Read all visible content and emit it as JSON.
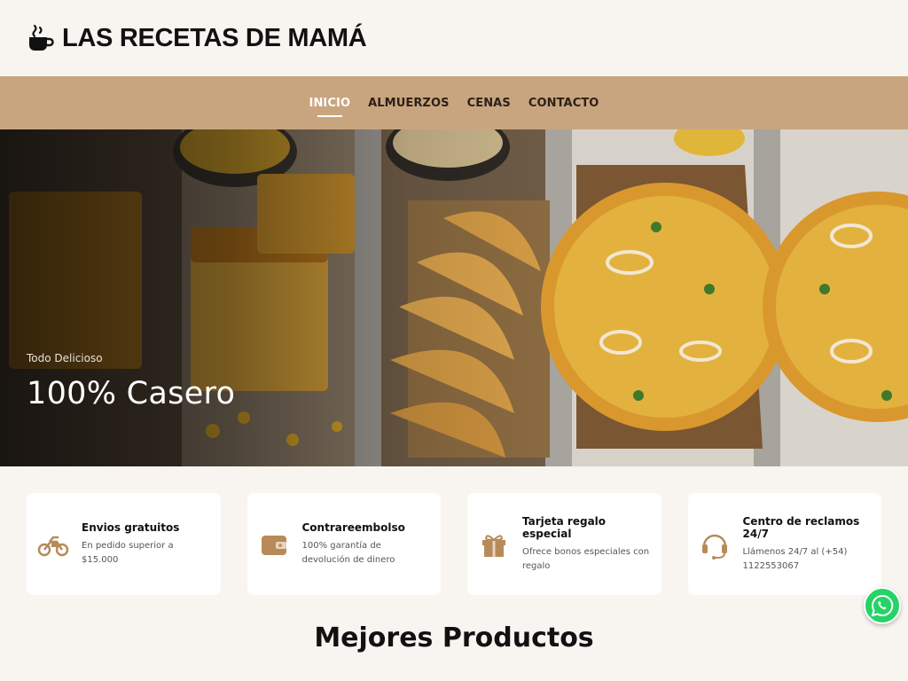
{
  "brand": {
    "name": "LAS RECETAS DE MAMÁ",
    "icon": "coffee-cup-icon"
  },
  "nav": {
    "items": [
      {
        "label": "INICIO",
        "active": true
      },
      {
        "label": "ALMUERZOS",
        "active": false
      },
      {
        "label": "CENAS",
        "active": false
      },
      {
        "label": "CONTACTO",
        "active": false
      }
    ]
  },
  "hero": {
    "subtitle": "Todo Delicioso",
    "title": "100% Casero"
  },
  "features": [
    {
      "icon": "motorcycle-icon",
      "title": "Envios gratuitos",
      "desc": "En pedido superior a $15.000"
    },
    {
      "icon": "wallet-icon",
      "title": "Contrareembolso",
      "desc": "100% garantía de devolución de dinero"
    },
    {
      "icon": "gift-icon",
      "title": "Tarjeta regalo especial",
      "desc": "Ofrece bonos especiales con regalo"
    },
    {
      "icon": "headset-icon",
      "title": "Centro de reclamos 24/7",
      "desc": "Llámenos 24/7 al (+54) 1122553067"
    }
  ],
  "section": {
    "title": "Mejores Productos"
  },
  "colors": {
    "accent": "#c9a57f",
    "icon": "#b88a5a",
    "background": "#f8f5f1",
    "whatsapp": "#25d366"
  }
}
